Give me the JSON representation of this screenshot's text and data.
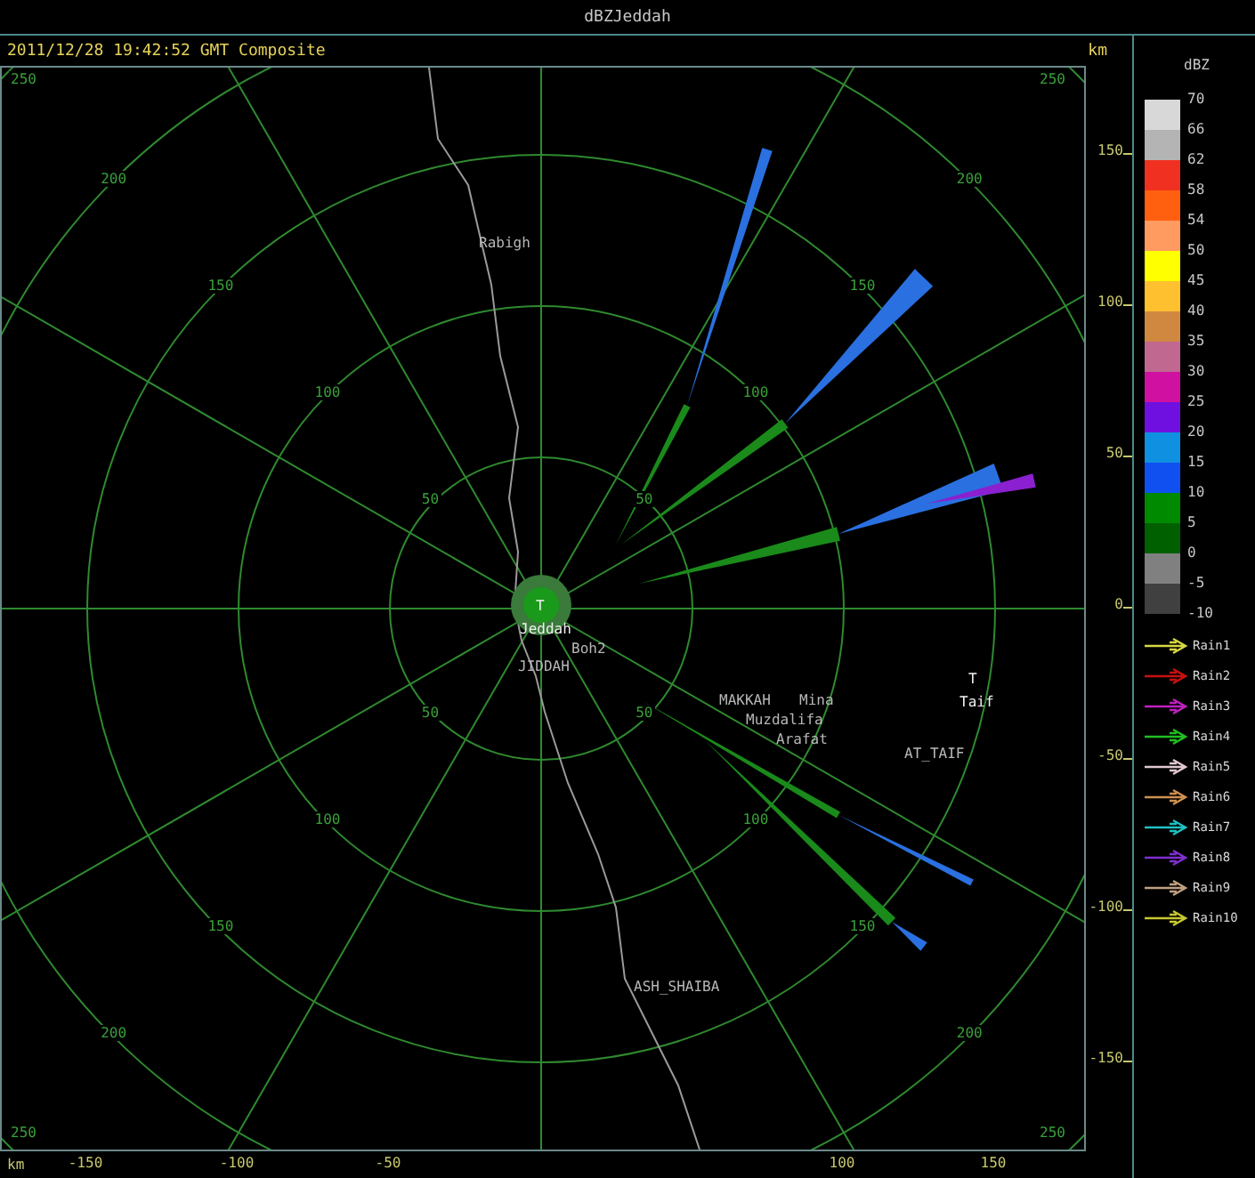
{
  "window": {
    "title": "dBZJeddah"
  },
  "header": {
    "timestamp": "2011/12/28 19:42:52 GMT Composite",
    "unit": "km"
  },
  "plot": {
    "range_labels": [
      {
        "text": "250",
        "kind": "corner"
      },
      {
        "text": "250",
        "kind": "corner"
      },
      {
        "text": "250",
        "kind": "corner"
      },
      {
        "text": "250",
        "kind": "corner"
      },
      {
        "text": "200",
        "kind": "nw"
      },
      {
        "text": "150",
        "kind": "nw"
      },
      {
        "text": "100",
        "kind": "nw"
      },
      {
        "text": "50",
        "kind": "nw"
      },
      {
        "text": "200",
        "kind": "ne"
      },
      {
        "text": "150",
        "kind": "ne"
      },
      {
        "text": "100",
        "kind": "ne"
      },
      {
        "text": "50",
        "kind": "ne"
      },
      {
        "text": "200",
        "kind": "sw"
      },
      {
        "text": "150",
        "kind": "sw"
      },
      {
        "text": "100",
        "kind": "sw"
      },
      {
        "text": "50",
        "kind": "sw"
      },
      {
        "text": "200",
        "kind": "se"
      },
      {
        "text": "150",
        "kind": "se"
      },
      {
        "text": "100",
        "kind": "se"
      },
      {
        "text": "50",
        "kind": "se"
      }
    ],
    "places": [
      {
        "text": "Rabigh",
        "kind": "label"
      },
      {
        "text": "T",
        "kind": "marker"
      },
      {
        "text": "Jeddah",
        "kind": "site"
      },
      {
        "text": "Boh2",
        "kind": "label"
      },
      {
        "text": "JIDDAH",
        "kind": "label"
      },
      {
        "text": "MAKKAH",
        "kind": "label"
      },
      {
        "text": "Mina",
        "kind": "label"
      },
      {
        "text": "Muzdalifa",
        "kind": "label"
      },
      {
        "text": "Arafat",
        "kind": "label"
      },
      {
        "text": "T",
        "kind": "marker"
      },
      {
        "text": "Taif",
        "kind": "site"
      },
      {
        "text": "AT_TAIF",
        "kind": "label"
      },
      {
        "text": "ASH_SHAIBA",
        "kind": "label"
      }
    ]
  },
  "right_axis": {
    "ticks": [
      "150",
      "100",
      "50",
      "0",
      "-50",
      "-100",
      "-150"
    ]
  },
  "bottom_axis": {
    "unit": "km",
    "ticks": [
      "-150",
      "-100",
      "-50",
      "100",
      "150"
    ]
  },
  "legend": {
    "title": "dBZ",
    "swatches": [
      {
        "color": "#d8d8d8"
      },
      {
        "color": "#b4b4b4"
      },
      {
        "color": "#f03020"
      },
      {
        "color": "#ff6010"
      },
      {
        "color": "#ff9a60"
      },
      {
        "color": "#ffff00"
      },
      {
        "color": "#ffc030"
      },
      {
        "color": "#d08840"
      },
      {
        "color": "#c06890"
      },
      {
        "color": "#d010a0"
      },
      {
        "color": "#7010e0"
      },
      {
        "color": "#1090e0"
      },
      {
        "color": "#1050f0"
      },
      {
        "color": "#008a00"
      },
      {
        "color": "#006000"
      },
      {
        "color": "#808080"
      },
      {
        "color": "#404040"
      }
    ],
    "scale": [
      "70",
      "66",
      "62",
      "58",
      "54",
      "50",
      "45",
      "40",
      "35",
      "30",
      "25",
      "20",
      "15",
      "10",
      "5",
      "0",
      "-5",
      "-10"
    ],
    "series": [
      {
        "name": "Rain1",
        "color": "#d8d840"
      },
      {
        "name": "Rain2",
        "color": "#c81010"
      },
      {
        "name": "Rain3",
        "color": "#c020c0"
      },
      {
        "name": "Rain4",
        "color": "#20c020"
      },
      {
        "name": "Rain5",
        "color": "#e0c8d0"
      },
      {
        "name": "Rain6",
        "color": "#d09050"
      },
      {
        "name": "Rain7",
        "color": "#20c0c0"
      },
      {
        "name": "Rain8",
        "color": "#8030d0"
      },
      {
        "name": "Rain9",
        "color": "#c0a080"
      },
      {
        "name": "Rain10",
        "color": "#c8c830"
      }
    ]
  }
}
